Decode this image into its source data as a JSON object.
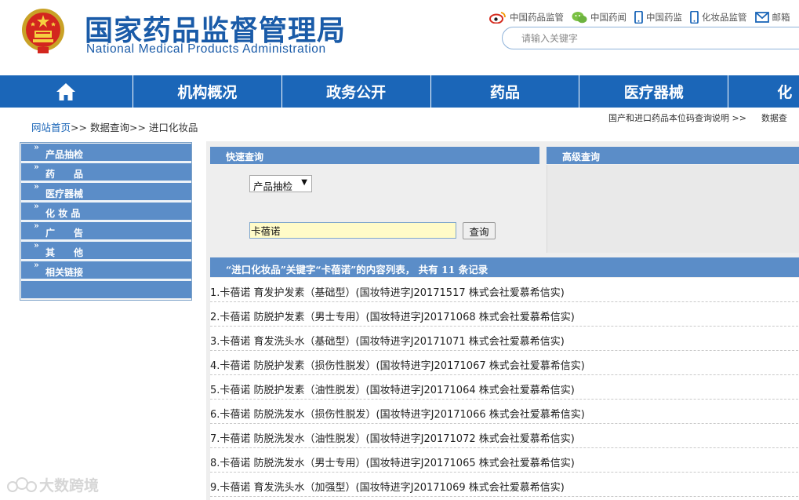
{
  "header": {
    "title_cn": "国家药品监督管理局",
    "title_en": "National Medical Products Administration",
    "top_links": [
      "中国药品监管",
      "中国药闻",
      "中国药监",
      "化妆品监管",
      "邮箱"
    ],
    "search_placeholder": "请输入关键字"
  },
  "nav": {
    "items": [
      "机构概况",
      "政务公开",
      "药品",
      "医疗器械",
      "化"
    ]
  },
  "breadcrumb": {
    "home": "网站首页",
    "sep1": ">>",
    "level2": "数据查询",
    "sep2": ">>",
    "level3": "进口化妆品"
  },
  "right_links": {
    "link1": "国产和进口药品本位码查询说明",
    "sep": ">>",
    "link2": "数据查"
  },
  "left_menu": {
    "items": [
      "产品抽检",
      "药　　品",
      "医疗器械",
      "化 妆 品",
      "广　　告",
      "其　　他",
      "相关链接"
    ]
  },
  "quick_search": {
    "title": "快速查询",
    "category_value": "产品抽检",
    "keyword_value": "卡蓓诺",
    "button_label": "查询"
  },
  "advanced_search": {
    "title": "高级查询"
  },
  "results": {
    "header": "“进口化妆品”关键字“卡蓓诺”的内容列表， 共有 11 条记录",
    "items": [
      "1.卡蓓诺 育发护发素（基础型）(国妆特进字J20171517 株式会社爱慕希信实)",
      "2.卡蓓诺 防脱护发素（男士专用）(国妆特进字J20171068 株式会社爱慕希信实)",
      "3.卡蓓诺 育发洗头水（基础型）(国妆特进字J20171071 株式会社爱慕希信实)",
      "4.卡蓓诺 防脱护发素（损伤性脱发）(国妆特进字J20171067 株式会社爱慕希信实)",
      "5.卡蓓诺 防脱护发素（油性脱发）(国妆特进字J20171064 株式会社爱慕希信实)",
      "6.卡蓓诺 防脱洗发水（损伤性脱发）(国妆特进字J20171066 株式会社爱慕希信实)",
      "7.卡蓓诺 防脱洗发水（油性脱发）(国妆特进字J20171072 株式会社爱慕希信实)",
      "8.卡蓓诺 防脱洗发水（男士专用）(国妆特进字J20171065 株式会社爱慕希信实)",
      "9.卡蓓诺 育发洗头水（加强型）(国妆特进字J20171069 株式会社爱慕希信实)"
    ]
  },
  "watermark": "大数跨境",
  "colors": {
    "brand_blue": "#1a5ba8",
    "nav_blue": "#1b66b8",
    "panel_blue": "#5b8dc8",
    "input_yellow": "#fffbc8"
  }
}
